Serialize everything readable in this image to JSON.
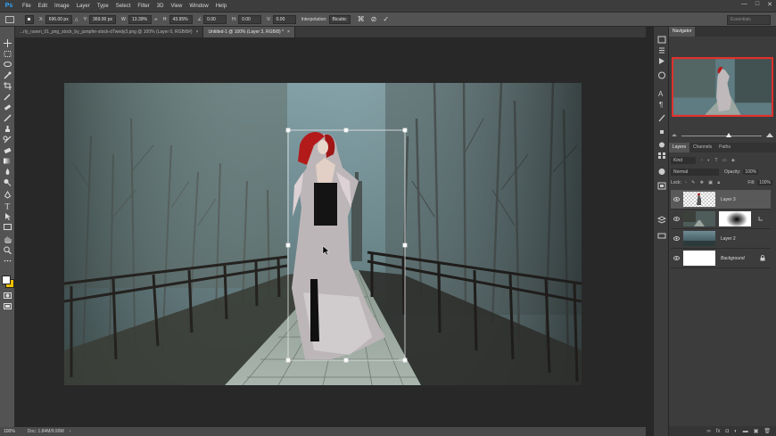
{
  "app": {
    "logo": "Ps"
  },
  "menu": [
    "File",
    "Edit",
    "Image",
    "Layer",
    "Type",
    "Select",
    "Filter",
    "3D",
    "View",
    "Window",
    "Help"
  ],
  "window_controls": [
    "—",
    "□",
    "✕"
  ],
  "options": {
    "x_label": "X:",
    "x_value": "696.00 px",
    "y_label": "Y:",
    "y_value": "369.00 px",
    "w_label": "W:",
    "w_value": "13.39%",
    "h_label": "H:",
    "h_value": "43.95%",
    "angle_value": "0.00",
    "hskew_label": "H:",
    "hskew_value": "0.00",
    "vskew_label": "V:",
    "vskew_value": "0.00",
    "interp_label": "Interpolation:",
    "interp_value": "Bicubic",
    "search_placeholder": "Essentials"
  },
  "tabs": [
    {
      "label": "...rly_raven_01_png_stock_by_jumpfer-stock-d7wedy3.png @ 100% (Layer 0, RGB/8#)",
      "close": "×",
      "active": false
    },
    {
      "label": "Untitled-1 @ 100% (Layer 3, RGB/8) *",
      "close": "×",
      "active": true
    }
  ],
  "status": {
    "zoom": "100%",
    "doc": "Doc: 1.84M/9.99M"
  },
  "navigator": {
    "title": "Navigator"
  },
  "layers_panel": {
    "tabs": [
      "Layers",
      "Channels",
      "Paths"
    ],
    "kind_label": "Kind",
    "blend_mode": "Normal",
    "opacity_label": "Opacity:",
    "opacity_value": "100%",
    "lock_label": "Lock:",
    "fill_label": "Fill:",
    "fill_value": "100%",
    "layers": [
      {
        "name": "Layer 3"
      },
      {
        "name": ""
      },
      {
        "name": "Layer 2"
      },
      {
        "name": "Background"
      }
    ]
  },
  "colors": {
    "accent_blue": "#31a8ff",
    "fg_swatch": "#ffffff",
    "bg_swatch": "#f2c100"
  }
}
